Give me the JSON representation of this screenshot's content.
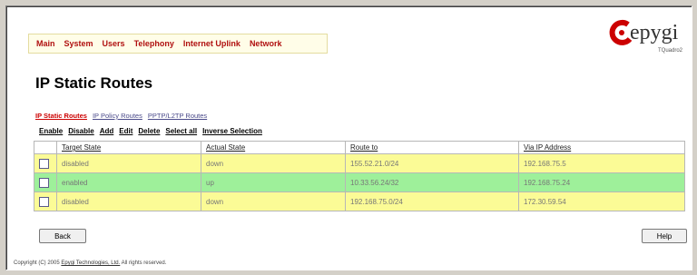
{
  "nav": [
    "Main",
    "System",
    "Users",
    "Telephony",
    "Internet Uplink",
    "Network"
  ],
  "logo": {
    "text": "epygi",
    "subtitle": "TQuadro2"
  },
  "page_title": "IP Static Routes",
  "subtabs": [
    "IP Static Routes",
    "IP Policy Routes",
    "PPTP/L2TP Routes"
  ],
  "actions": [
    "Enable",
    "Disable",
    "Add",
    "Edit",
    "Delete",
    "Select all",
    "Inverse Selection"
  ],
  "table": {
    "headers": [
      "Target State",
      "Actual State",
      "Route to",
      "Via IP Address"
    ],
    "rows": [
      [
        "disabled",
        "down",
        "155.52.21.0/24",
        "192.168.75.5"
      ],
      [
        "enabled",
        "up",
        "10.33.56.24/32",
        "192.168.75.24"
      ],
      [
        "disabled",
        "down",
        "192.168.75.0/24",
        "172.30.59.54"
      ]
    ]
  },
  "buttons": {
    "back": "Back",
    "help": "Help"
  },
  "footer": {
    "prefix": "Copyright (C) 2005 ",
    "link": "Epygi Technologies, Ltd.",
    "suffix": " All rights reserved."
  },
  "colors": {
    "disabled_row": "#fbfb96",
    "enabled_row": "#9ef09a",
    "nav_text": "#b01010",
    "logo_red": "#cc0000"
  }
}
